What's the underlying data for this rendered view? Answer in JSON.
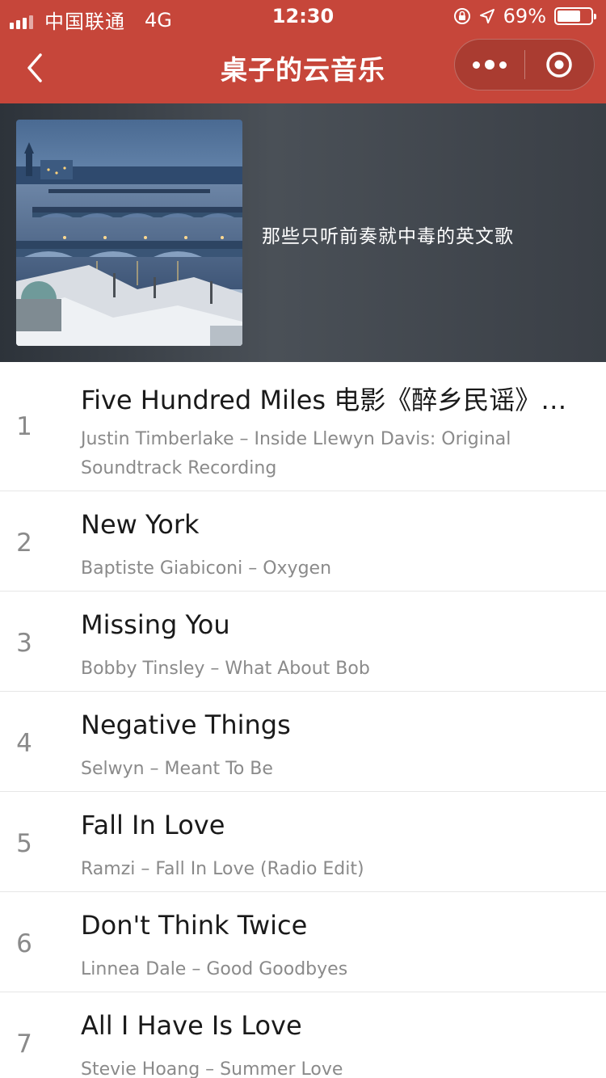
{
  "status_bar": {
    "carrier": "中国联通",
    "network": "4G",
    "time": "12:30",
    "battery": "69%",
    "battery_level": 0.69
  },
  "nav": {
    "title": "桌子的云音乐",
    "icons": {
      "back": "chevron-left-icon",
      "more": "more-dots-icon",
      "close": "target-close-icon"
    }
  },
  "playlist": {
    "name": "那些只听前奏就中毒的英文歌",
    "cover_icon": "playlist-cover-image"
  },
  "songs": [
    {
      "index": "1",
      "title": "Five Hundred Miles 电影《醉乡民谣》…",
      "subtitle": "Justin Timberlake – Inside Llewyn Davis: Original Soundtrack Recording"
    },
    {
      "index": "2",
      "title": "New York",
      "subtitle": "Baptiste Giabiconi – Oxygen"
    },
    {
      "index": "3",
      "title": "Missing You",
      "subtitle": "Bobby Tinsley – What About Bob"
    },
    {
      "index": "4",
      "title": "Negative Things",
      "subtitle": "Selwyn – Meant To Be"
    },
    {
      "index": "5",
      "title": "Fall In Love",
      "subtitle": "Ramzi – Fall In Love (Radio Edit)"
    },
    {
      "index": "6",
      "title": "Don't Think Twice",
      "subtitle": "Linnea Dale – Good Goodbyes"
    },
    {
      "index": "7",
      "title": "All I Have Is Love",
      "subtitle": "Stevie Hoang – Summer Love"
    }
  ],
  "colors": {
    "nav_red": "#c6463a",
    "text_primary": "#1a1a1a",
    "text_secondary": "#8a8a8a"
  }
}
